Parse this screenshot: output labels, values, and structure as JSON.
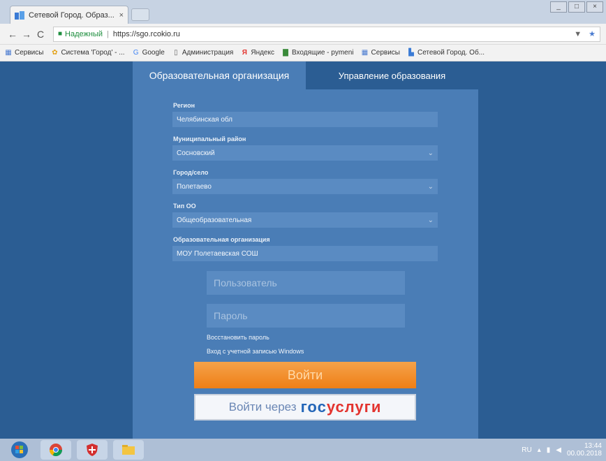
{
  "browser": {
    "tab_title": "Сетевой Город. Образ...",
    "tab_close": "×",
    "nav": {
      "back": "←",
      "forward": "→",
      "reload": "C"
    },
    "address": {
      "secure_label": "Надежный",
      "url": "https://sgo.rcokio.ru"
    },
    "bookmarks": [
      {
        "icon": "apps-icon",
        "label": "Сервисы"
      },
      {
        "icon": "network-city-icon",
        "label": "Система 'Город' - ..."
      },
      {
        "icon": "google-icon",
        "label": "Google"
      },
      {
        "icon": "page-icon",
        "label": "Администрация"
      },
      {
        "icon": "yandex-icon",
        "label": "Яндекс"
      },
      {
        "icon": "book-icon",
        "label": "Входящие - pymeni"
      },
      {
        "icon": "apps-icon",
        "label": "Сервисы"
      },
      {
        "icon": "network-city-icon",
        "label": "Сетевой Город. Об..."
      }
    ]
  },
  "page": {
    "tabs": {
      "org": "Образовательная организация",
      "gov": "Управление образования"
    },
    "fields": {
      "region": {
        "label": "Регион",
        "value": "Челябинская обл"
      },
      "district": {
        "label": "Муниципальный район",
        "value": "Сосновский"
      },
      "town": {
        "label": "Город/село",
        "value": "Полетаево"
      },
      "school_type": {
        "label": "Тип ОО",
        "value": "Общеобразовательная"
      },
      "school": {
        "label": "Образовательная организация",
        "value": "МОУ Полетаевская СОШ"
      }
    },
    "login": {
      "user_placeholder": "Пользователь",
      "password_placeholder": "Пароль"
    },
    "links": {
      "restore": "Восстановить пароль",
      "windows": "Вход с учетной записью Windows"
    },
    "buttons": {
      "login": "Войти",
      "gos_prefix": "Войти через",
      "gos_part1": "гос",
      "gos_part2": "услуги"
    }
  },
  "taskbar": {
    "lang": "RU",
    "time": "13:44",
    "date": "00.00.2018"
  },
  "colors": {
    "background": "#2b5d93",
    "panel": "#4a7db6",
    "field": "#5a8bc2",
    "login_button": "#ef7f16",
    "gos_blue": "#2466b8",
    "gos_red": "#e3342f"
  }
}
